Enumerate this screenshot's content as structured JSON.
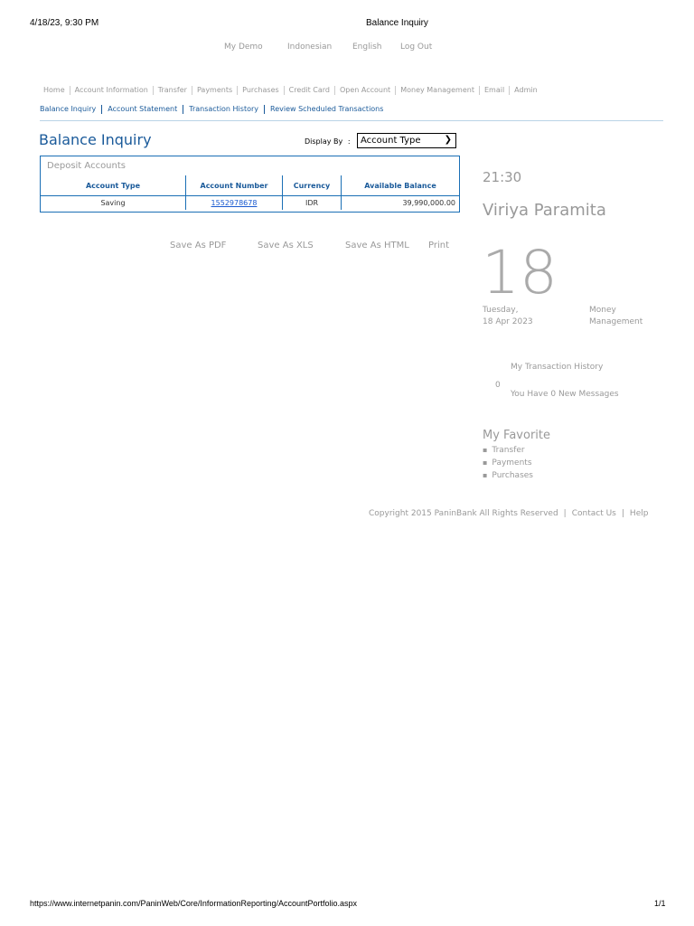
{
  "print_header": {
    "datetime": "4/18/23, 9:30 PM",
    "title": "Balance Inquiry"
  },
  "top_nav": [
    "My Demo",
    "Indonesian",
    "English",
    "Log Out"
  ],
  "main_nav": [
    "Home",
    "Account Information",
    "Transfer",
    "Payments",
    "Purchases",
    "Credit Card",
    "Open Account",
    "Money Management",
    "Email",
    "Admin"
  ],
  "sub_nav": [
    "Balance Inquiry",
    "Account Statement",
    "Transaction History",
    "Review Scheduled Transactions"
  ],
  "page": {
    "title": "Balance Inquiry",
    "display_by_label": "Display By",
    "display_by_colon": ":",
    "display_by_value": "Account Type"
  },
  "deposit": {
    "caption": "Deposit Accounts",
    "headers": [
      "Account Type",
      "Account Number",
      "Currency",
      "Available Balance"
    ],
    "row": {
      "type": "Saving",
      "number": "1552978678",
      "currency": "IDR",
      "balance": "39,990,000.00"
    }
  },
  "actions": [
    "Save As PDF",
    "Save As XLS",
    "Save As HTML",
    "Print"
  ],
  "sidebar": {
    "time": "21:30",
    "user": "Viriya Paramita",
    "day": "18",
    "weekday": "Tuesday,",
    "date": "18 Apr 2023",
    "money_mgmt_line1": "Money",
    "money_mgmt_line2": "Management",
    "transaction_history": "My Transaction History",
    "message_count": "0",
    "messages": "You Have 0 New Messages",
    "favorite_title": "My Favorite",
    "favorites": [
      "Transfer",
      "Payments",
      "Purchases"
    ]
  },
  "footer": {
    "copyright": "Copyright 2015 PaninBank All Rights Reserved",
    "sep": "|",
    "contact": "Contact Us",
    "help": "Help"
  },
  "print_footer": {
    "url": "https://www.internetpanin.com/PaninWeb/Core/InformationReporting/AccountPortfolio.aspx",
    "page": "1/1"
  },
  "colors": {
    "accent": "#1a5a9a",
    "border": "#1a6fb5",
    "muted": "#999999"
  }
}
